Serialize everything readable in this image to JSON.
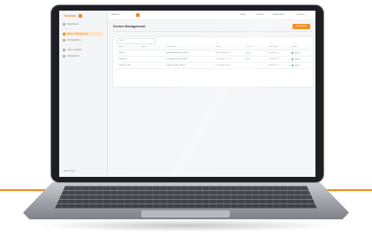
{
  "brand": {
    "name": "Vezando",
    "accent": "#f28c1b"
  },
  "sidebar": {
    "items": [
      {
        "label": "Dashboard"
      },
      {
        "label": "Device Management"
      },
      {
        "label": "Configuration"
      },
      {
        "label": "Users & Roles"
      },
      {
        "label": "Integrations"
      }
    ],
    "footer": "Help & Docs"
  },
  "topbar": {
    "breadcrumb": "Devices",
    "items": [
      "Alerts",
      "Support",
      "Organization",
      "Account"
    ]
  },
  "page": {
    "title": "Device Management",
    "add_button": "Add device",
    "search_placeholder": "Filter"
  },
  "table": {
    "columns": [
      "Name",
      "Type",
      "Description",
      "Serial",
      "Location",
      "Last seen",
      "Status"
    ],
    "rows": [
      [
        "Device",
        "",
        "Manufacturing line sensor",
        "0012-8A3F-91C2",
        "Hall A",
        "2024-05-12",
        "Online"
      ],
      [
        "Gateway",
        "",
        "Packaging unit controller",
        "0012-8A3F-77D4",
        "Hall B",
        "2024-05-12",
        "Online"
      ],
      [
        "Controller Unit",
        "",
        "Quality control station",
        "0012-8A3F-55B1",
        "",
        "2024-05-11",
        "Online"
      ]
    ],
    "status_color": "#2bb673"
  }
}
